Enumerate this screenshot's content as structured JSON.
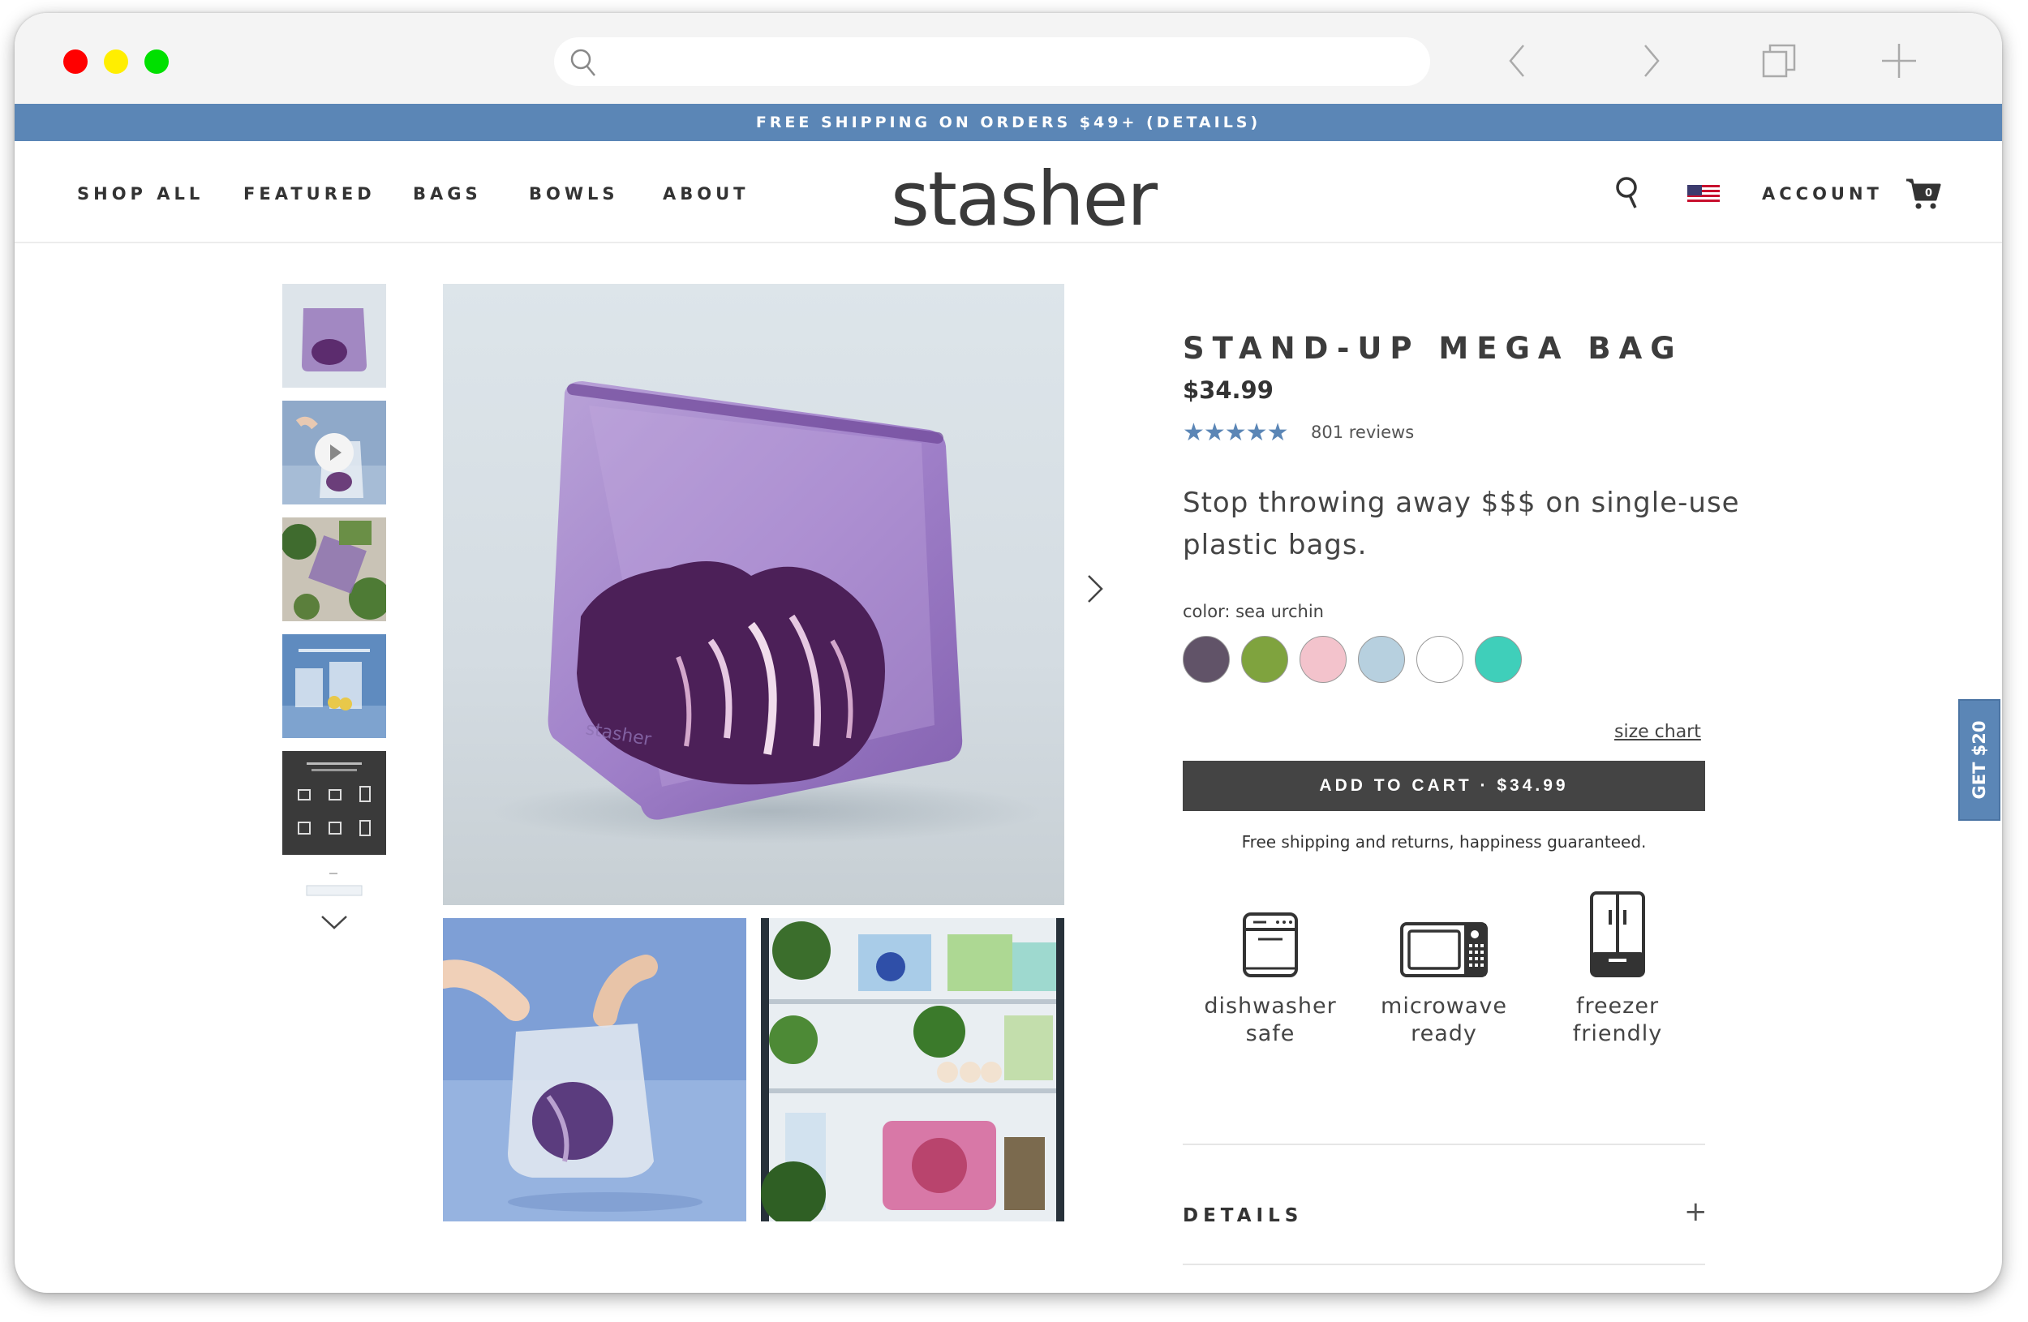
{
  "colors": {
    "accent": "#5b86b6",
    "button": "#444444",
    "swatches": [
      "#615368",
      "#7fa33e",
      "#f3c3cc",
      "#b7d0df",
      "#ffffff",
      "#3fcfba"
    ]
  },
  "banner": {
    "text": "FREE SHIPPING ON ORDERS $49+ (DETAILS)"
  },
  "nav": {
    "items": [
      "SHOP ALL",
      "FEATURED",
      "BAGS",
      "BOWLS",
      "ABOUT"
    ],
    "logo": "stasher",
    "account": "ACCOUNT",
    "cart_count": "0"
  },
  "product": {
    "title": "STAND-UP MEGA BAG",
    "price": "$34.99",
    "stars": "★★★★★",
    "reviews": "801 reviews",
    "tagline": "Stop throwing away $$$ on single-use plastic bags.",
    "color_label": "color: sea urchin",
    "size_chart": "size chart",
    "add_to_cart": "ADD TO CART · $34.99",
    "shipping_note": "Free shipping and returns, happiness guaranteed.",
    "features": [
      {
        "icon": "dishwasher-icon",
        "line1": "dishwasher",
        "line2": "safe"
      },
      {
        "icon": "microwave-icon",
        "line1": "microwave",
        "line2": "ready"
      },
      {
        "icon": "freezer-icon",
        "line1": "freezer",
        "line2": "friendly"
      }
    ],
    "details_label": "DETAILS",
    "details_toggle": "+"
  },
  "promo": {
    "label": "GET $20"
  },
  "gallery": {
    "bag_brand": "stasher"
  }
}
